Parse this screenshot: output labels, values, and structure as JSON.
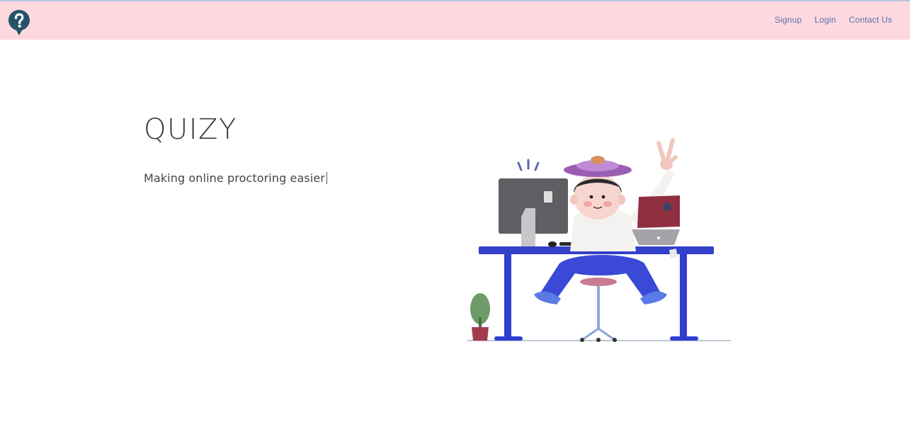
{
  "nav": {
    "logo_icon": "question-mark-pin-icon",
    "links": [
      "Signup",
      "Login",
      "Contact Us"
    ]
  },
  "hero": {
    "title": "QUIZY",
    "subtitle": "Making online proctoring easier"
  },
  "colors": {
    "navbar_bg": "#fdd9df",
    "link": "#5a6fa8",
    "logo": "#24546a",
    "desk": "#3340c9"
  }
}
